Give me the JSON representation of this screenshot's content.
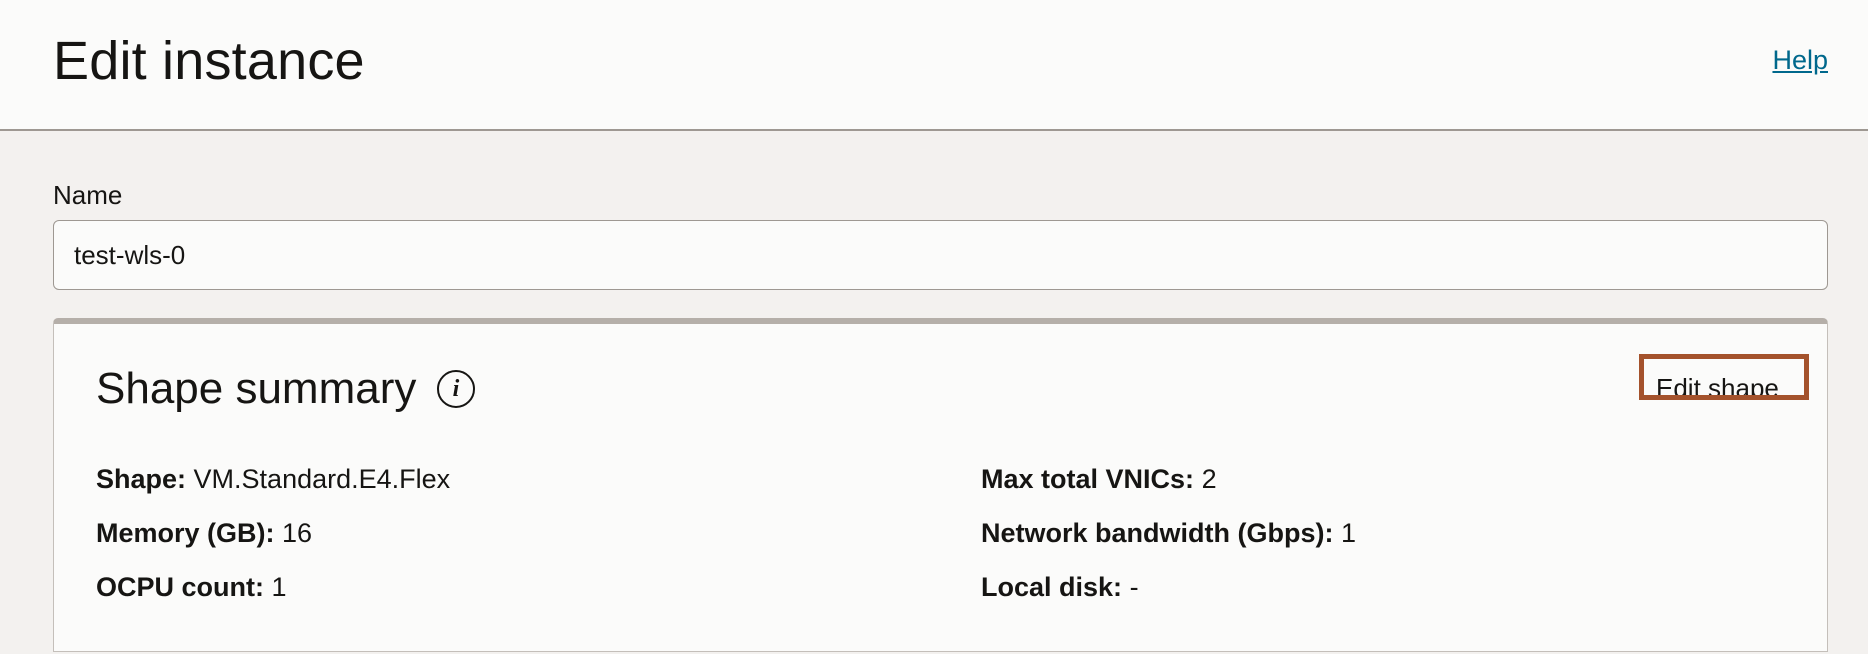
{
  "header": {
    "title": "Edit instance",
    "help_label": "Help"
  },
  "name_field": {
    "label": "Name",
    "value": "test-wls-0"
  },
  "shape_summary": {
    "title": "Shape summary",
    "info_icon": "info-icon",
    "edit_label": "Edit shape",
    "edit_highlight_color": "#a4522c",
    "left": [
      {
        "key": "Shape:",
        "value": "VM.Standard.E4.Flex"
      },
      {
        "key": "Memory (GB):",
        "value": "16"
      },
      {
        "key": "OCPU count:",
        "value": "1"
      }
    ],
    "right": [
      {
        "key": "Max total VNICs:",
        "value": "2"
      },
      {
        "key": "Network bandwidth (Gbps):",
        "value": "1"
      },
      {
        "key": "Local disk:",
        "value": "-"
      }
    ]
  },
  "colors": {
    "link": "#00688c",
    "page_bg": "#f3f1ef",
    "panel_bg": "#fbfbfa"
  }
}
